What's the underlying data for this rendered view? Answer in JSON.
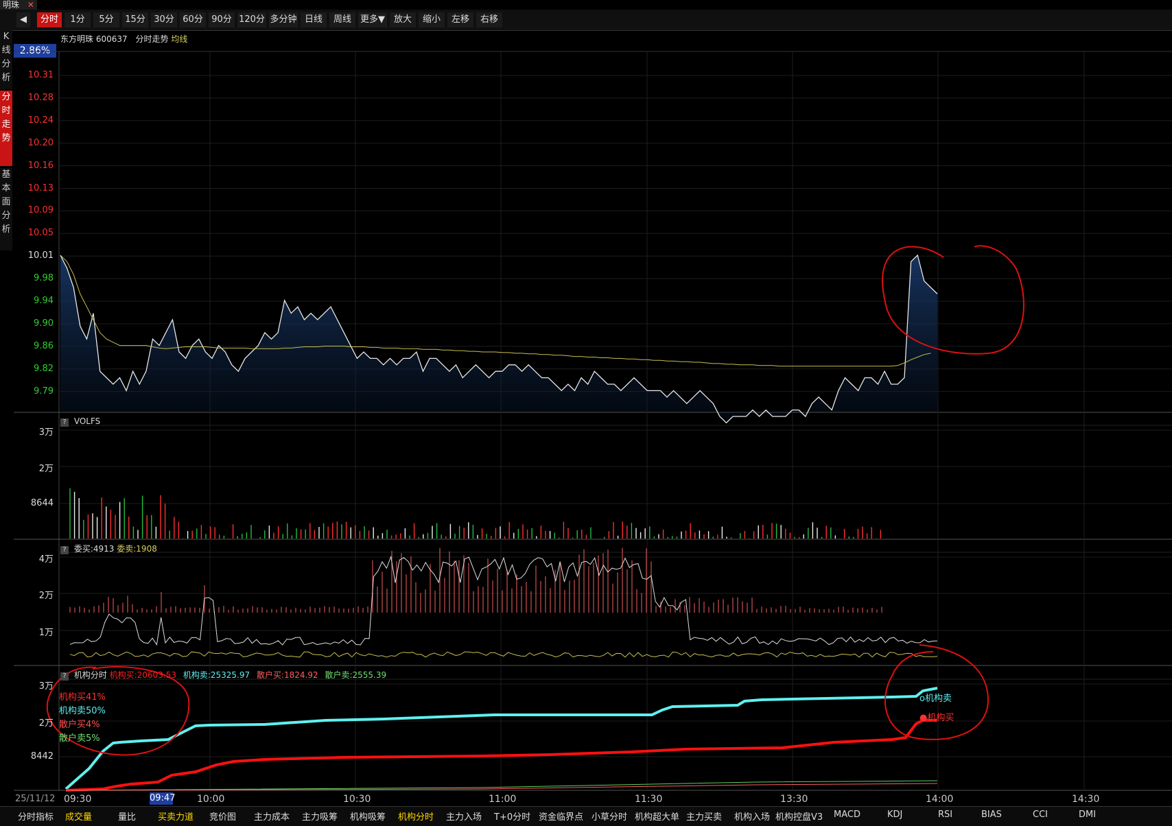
{
  "window": {
    "tab_title": "明珠",
    "tab_close": "✕"
  },
  "toolbar": {
    "back": "◀",
    "buttons": [
      "分时",
      "1分",
      "5分",
      "15分",
      "30分",
      "60分",
      "90分",
      "120分",
      "多分钟",
      "日线",
      "周线",
      "更多▼",
      "放大",
      "缩小",
      "左移",
      "右移"
    ],
    "active": "分时"
  },
  "sidebar": {
    "tabs": [
      {
        "label": "K\n线\n分\n析",
        "active": false
      },
      {
        "label": "分\n时\n走\n势",
        "active": true
      },
      {
        "label": "基\n本\n面\n分\n析",
        "active": false
      }
    ]
  },
  "header": {
    "stock_name": "东方明珠",
    "code": "600637",
    "chart_name": "分时走势",
    "avg_label": "均线",
    "pct": "2.86%"
  },
  "price_axis": [
    "10.31",
    "10.28",
    "10.24",
    "10.20",
    "10.16",
    "10.13",
    "10.09",
    "10.05",
    "10.01",
    "9.98",
    "9.94",
    "9.90",
    "9.86",
    "9.82",
    "9.79"
  ],
  "panels": {
    "vol": {
      "title": "VOLFS",
      "ticks": [
        "3万",
        "2万",
        "8644"
      ]
    },
    "order": {
      "title_a": "委买:4913",
      "title_b": "委卖:1908",
      "ticks": [
        "4万",
        "2万",
        "1万"
      ]
    },
    "inst": {
      "title": "机构分时",
      "v1": "机构买:20603.53",
      "v2": "机构卖:25325.97",
      "v3": "散户买:1824.92",
      "v4": "散户卖:2555.39",
      "ticks": [
        "3万",
        "2万",
        "8442"
      ],
      "legend_left": [
        "机构买41%",
        "机构卖50%",
        "散户买4%",
        "散户卖5%"
      ],
      "legend_right": [
        "o机构卖",
        "●机构买"
      ]
    }
  },
  "time_axis": {
    "date": "25/11/12",
    "cursor": "09:47",
    "labels": [
      "09:30",
      "10:00",
      "10:30",
      "11:00",
      "11:30",
      "13:30",
      "14:00",
      "14:30"
    ]
  },
  "bottom_tabs": [
    "分时指标",
    "成交量",
    "量比",
    "买卖力道",
    "竞价图",
    "主力成本",
    "主力吸筹",
    "机构吸筹",
    "机构分时",
    "主力入场",
    "T+0分时",
    "资金临界点",
    "小草分时",
    "机构超大单",
    "主力买卖",
    "机构入场",
    "机构控盘V3",
    "MACD",
    "KDJ",
    "RSI",
    "BIAS",
    "CCI",
    "DMI"
  ],
  "bottom_tabs_highlight": [
    "成交量",
    "买卖力道",
    "机构分时"
  ],
  "chart_data": {
    "type": "line",
    "title": "东方明珠 600637 分时走势",
    "ylim": [
      9.77,
      10.33
    ],
    "price_series": [
      10.01,
      9.99,
      9.96,
      9.9,
      9.88,
      9.92,
      9.83,
      9.82,
      9.81,
      9.82,
      9.8,
      9.83,
      9.81,
      9.83,
      9.88,
      9.87,
      9.89,
      9.91,
      9.86,
      9.85,
      9.87,
      9.88,
      9.86,
      9.85,
      9.87,
      9.86,
      9.84,
      9.83,
      9.85,
      9.86,
      9.87,
      9.89,
      9.88,
      9.89,
      9.94,
      9.92,
      9.93,
      9.91,
      9.92,
      9.91,
      9.92,
      9.93,
      9.91,
      9.89,
      9.87,
      9.85,
      9.86,
      9.85,
      9.85,
      9.84,
      9.85,
      9.84,
      9.85,
      9.85,
      9.86,
      9.83,
      9.85,
      9.85,
      9.84,
      9.83,
      9.84,
      9.82,
      9.83,
      9.84,
      9.83,
      9.82,
      9.83,
      9.83,
      9.84,
      9.84,
      9.83,
      9.84,
      9.83,
      9.82,
      9.82,
      9.81,
      9.8,
      9.81,
      9.8,
      9.82,
      9.81,
      9.83,
      9.82,
      9.81,
      9.81,
      9.8,
      9.81,
      9.82,
      9.81,
      9.8,
      9.8,
      9.8,
      9.79,
      9.8,
      9.79,
      9.78,
      9.79,
      9.8,
      9.79,
      9.78,
      9.76,
      9.75,
      9.76,
      9.76,
      9.76,
      9.77,
      9.76,
      9.77,
      9.76,
      9.76,
      9.76,
      9.77,
      9.77,
      9.76,
      9.78,
      9.79,
      9.78,
      9.77,
      9.8,
      9.82,
      9.81,
      9.8,
      9.82,
      9.82,
      9.81,
      9.83,
      9.81,
      9.81,
      9.82,
      10.0,
      10.01,
      9.97,
      9.96,
      9.95
    ],
    "avg_series": [
      10.01,
      10.0,
      9.98,
      9.95,
      9.93,
      9.91,
      9.89,
      9.88,
      9.875,
      9.87,
      9.87,
      9.87,
      9.87,
      9.87,
      9.868,
      9.866,
      9.865,
      9.866,
      9.867,
      9.868,
      9.868,
      9.868,
      9.868,
      9.867,
      9.866,
      9.866,
      9.866,
      9.866,
      9.866,
      9.865,
      9.865,
      9.865,
      9.865,
      9.865,
      9.866,
      9.866,
      9.867,
      9.868,
      9.868,
      9.868,
      9.869,
      9.869,
      9.869,
      9.869,
      9.868,
      9.868,
      9.868,
      9.867,
      9.867,
      9.866,
      9.866,
      9.866,
      9.865,
      9.865,
      9.865,
      9.864,
      9.864,
      9.864,
      9.863,
      9.863,
      9.862,
      9.862,
      9.861,
      9.861,
      9.86,
      9.86,
      9.86,
      9.859,
      9.859,
      9.858,
      9.858,
      9.857,
      9.857,
      9.856,
      9.856,
      9.855,
      9.855,
      9.854,
      9.853,
      9.853,
      9.852,
      9.852,
      9.851,
      9.851,
      9.85,
      9.85,
      9.849,
      9.849,
      9.848,
      9.848,
      9.847,
      9.847,
      9.846,
      9.846,
      9.845,
      9.845,
      9.844,
      9.844,
      9.843,
      9.842,
      9.842,
      9.841,
      9.841,
      9.84,
      9.84,
      9.84,
      9.839,
      9.839,
      9.839,
      9.838,
      9.838,
      9.838,
      9.838,
      9.838,
      9.838,
      9.838,
      9.838,
      9.838,
      9.838,
      9.838,
      9.838,
      9.838,
      9.838,
      9.838,
      9.838,
      9.838,
      9.838,
      9.839,
      9.843,
      9.848,
      9.852,
      9.856,
      9.858
    ]
  }
}
